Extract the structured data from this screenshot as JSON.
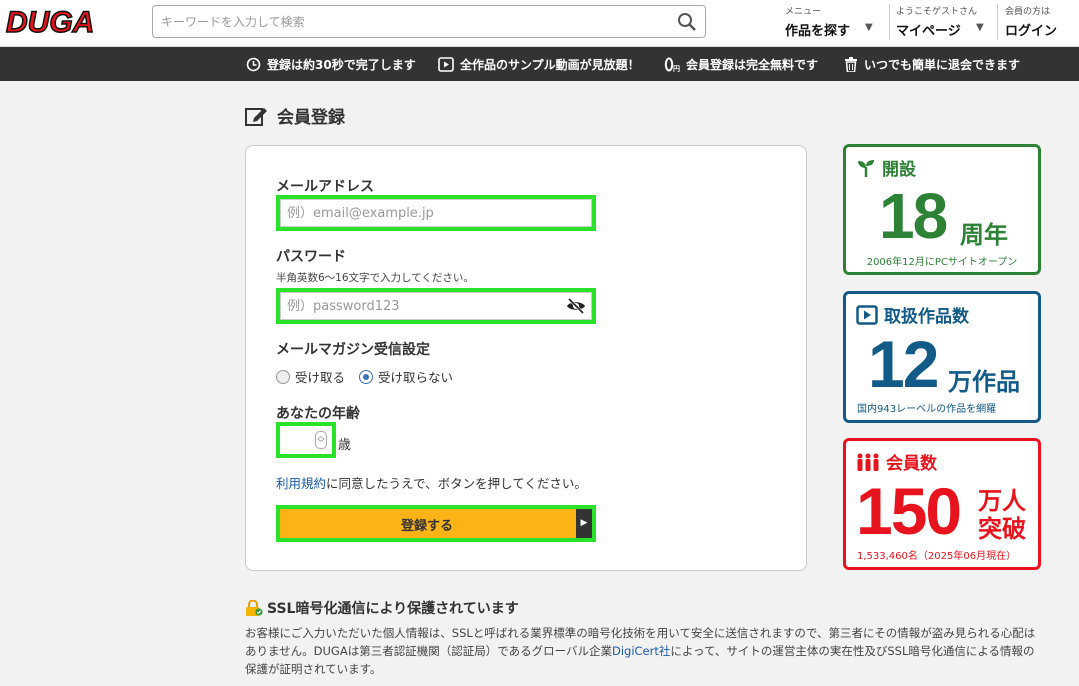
{
  "header": {
    "logo_text": "DUGA",
    "search_placeholder": "キーワードを入力して検索",
    "menu_small": "メニュー",
    "menu_big": "作品を探す",
    "guest_small": "ようこそゲストさん",
    "guest_big": "マイページ",
    "member_small": "会員の方は",
    "member_big": "ログイン"
  },
  "infobar": {
    "item1": "登録は約30秒で完了します",
    "item2": "全作品のサンプル動画が見放題！",
    "item3": "会員登録は完全無料です",
    "item4": "いつでも簡単に退会できます"
  },
  "page": {
    "title": "会員登録"
  },
  "form": {
    "email_label": "メールアドレス",
    "email_placeholder": "例）email@example.jp",
    "password_label": "パスワード",
    "password_hint": "半角英数6〜16文字で入力してください。",
    "password_placeholder": "例）password123",
    "newsletter_label": "メールマガジン受信設定",
    "newsletter_options": [
      "受け取る",
      "受け取らない"
    ],
    "newsletter_selected": "受け取らない",
    "age_label": "あなたの年齢",
    "age_unit": "歳",
    "terms_link": "利用規約",
    "agree_text": "に同意したうえで、ボタンを押してください。",
    "submit_label": "登録する"
  },
  "stats": {
    "founded": {
      "head": "開設",
      "number": "18",
      "unit": "周年",
      "foot": "2006年12月にPCサイトオープン"
    },
    "works": {
      "head": "取扱作品数",
      "number": "12",
      "unit": "万作品",
      "foot": "国内943レーベルの作品を網羅"
    },
    "members": {
      "head": "会員数",
      "number": "150",
      "unit_line1": "万人",
      "unit_line2": "突破",
      "foot": "1,533,460名（2025年06月現在）"
    }
  },
  "ssl": {
    "title": "SSL暗号化通信により保護されています",
    "text_before": "お客様にご入力いただいた個人情報は、SSLと呼ばれる業界標準の暗号化技術を用いて安全に送信されますので、第三者にその情報が盗み見られる心配はありません。DUGAは第三者認証機関（認証局）であるグローバル企業",
    "link": "DigiCert社",
    "text_after": "によって、サイトの運営主体の実在性及びSSL暗号化通信による情報の保護が証明されています。"
  },
  "colors": {
    "accent_submit": "#fcb316",
    "highlight": "#29e229",
    "founded": "#2e8236",
    "works": "#125a87",
    "members": "#e8141d",
    "logo": "#e8141d"
  }
}
